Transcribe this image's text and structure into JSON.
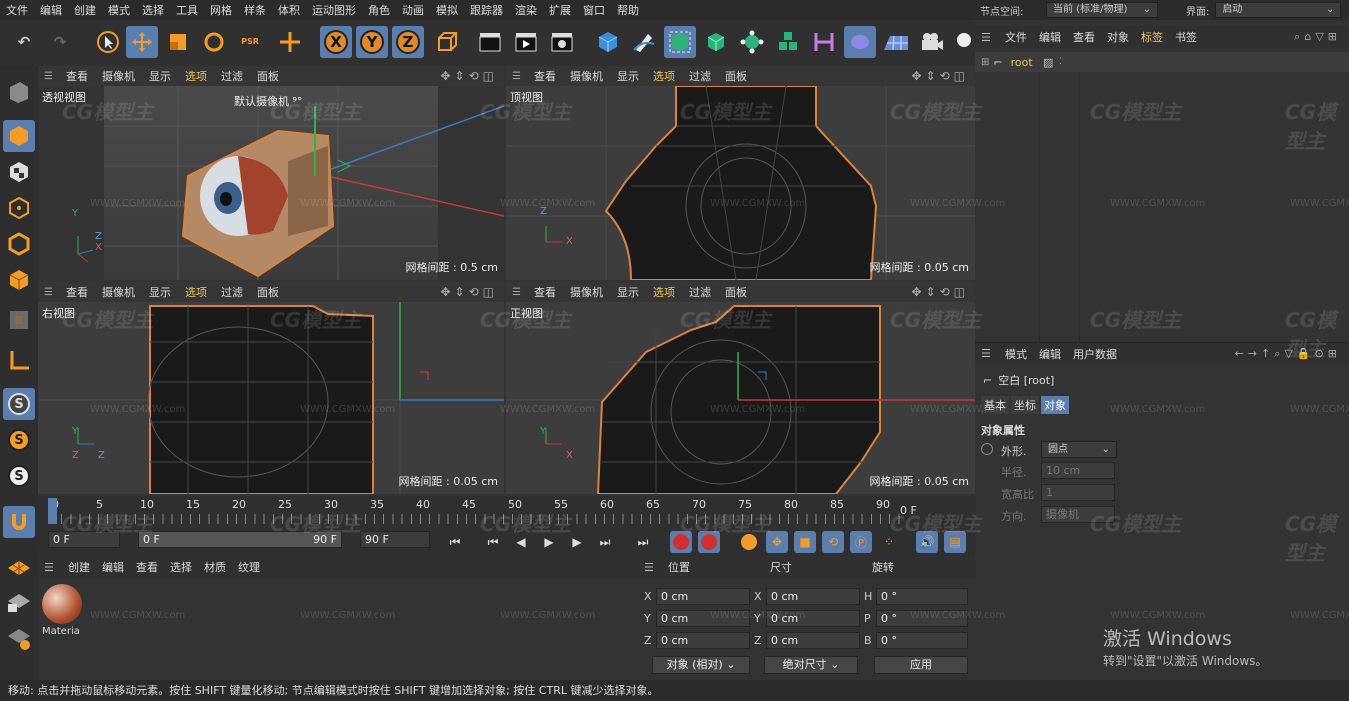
{
  "menu": [
    "文件",
    "编辑",
    "创建",
    "模式",
    "选择",
    "工具",
    "网格",
    "样条",
    "体积",
    "运动图形",
    "角色",
    "动画",
    "模拟",
    "跟踪器",
    "渲染",
    "扩展",
    "窗口",
    "帮助"
  ],
  "node_space": {
    "label": "节点空间:",
    "value": "当前 (标准/物理)"
  },
  "interface": {
    "label": "界面:",
    "value": "启动"
  },
  "toolbar": {
    "undo": "↶",
    "redo": "↷",
    "x": "X",
    "y": "Y",
    "z": "Z",
    "psr": "PSR"
  },
  "viewports": [
    {
      "name": "透视视图",
      "camera": "默认摄像机 ⁹°",
      "grid": "网格间距 : 0.5 cm",
      "menu": [
        "查看",
        "摄像机",
        "显示",
        "选项",
        "过滤",
        "面板"
      ]
    },
    {
      "name": "顶视图",
      "grid": "网格间距 : 0.05 cm",
      "menu": [
        "查看",
        "摄像机",
        "显示",
        "选项",
        "过滤",
        "面板"
      ]
    },
    {
      "name": "右视图",
      "grid": "网格间距 : 0.05 cm",
      "menu": [
        "查看",
        "摄像机",
        "显示",
        "选项",
        "过滤",
        "面板"
      ]
    },
    {
      "name": "正视图",
      "grid": "网格间距 : 0.05 cm",
      "menu": [
        "查看",
        "摄像机",
        "显示",
        "选项",
        "过滤",
        "面板"
      ]
    }
  ],
  "timeline": {
    "ticks": [
      "0",
      "5",
      "10",
      "15",
      "20",
      "25",
      "30",
      "35",
      "40",
      "45",
      "50",
      "55",
      "60",
      "65",
      "70",
      "75",
      "80",
      "85",
      "90"
    ],
    "current_frame": "0 F",
    "start": "0 F",
    "range_start": "0 F",
    "range_end": "90 F",
    "end": "90 F"
  },
  "material": {
    "menu": [
      "创建",
      "编辑",
      "查看",
      "选择",
      "材质",
      "纹理"
    ],
    "item": "Materia"
  },
  "coords": {
    "headers": [
      "位置",
      "尺寸",
      "旋转"
    ],
    "rows": [
      {
        "a": "X",
        "av": "0 cm",
        "b": "X",
        "bv": "0 cm",
        "c": "H",
        "cv": "0 °"
      },
      {
        "a": "Y",
        "av": "0 cm",
        "b": "Y",
        "bv": "0 cm",
        "c": "P",
        "cv": "0 °"
      },
      {
        "a": "Z",
        "av": "0 cm",
        "b": "Z",
        "bv": "0 cm",
        "c": "B",
        "cv": "0 °"
      }
    ],
    "mode": "对象 (相对)",
    "size_mode": "绝对尺寸",
    "apply": "应用"
  },
  "objects": {
    "menu": [
      "文件",
      "编辑",
      "查看",
      "对象",
      "标签",
      "书签"
    ],
    "root": "root"
  },
  "attributes": {
    "menu": [
      "模式",
      "编辑",
      "用户数据"
    ],
    "title": "空白 [root]",
    "tabs": [
      "基本",
      "坐标",
      "对象"
    ],
    "section": "对象属性",
    "props": [
      {
        "label": "外形.",
        "value": "圆点"
      },
      {
        "label": "半径.",
        "value": "10 cm"
      },
      {
        "label": "宽高比",
        "value": "1"
      },
      {
        "label": "方向.",
        "value": "摄像机"
      }
    ]
  },
  "activation": {
    "title": "激活 Windows",
    "sub": "转到\"设置\"以激活 Windows。"
  },
  "status": "移动: 点击并拖动鼠标移动元素。按住 SHIFT 键量化移动; 节点编辑模式时按住 SHIFT 键增加选择对象; 按住 CTRL 键减少选择对象。",
  "watermark": {
    "brand": "CG模型主",
    "url": "WWW.CGMXW.com"
  },
  "colors": {
    "accent": "#5a7fae",
    "selected_text": "#e8c766",
    "orange_outline": "#d9843a"
  }
}
